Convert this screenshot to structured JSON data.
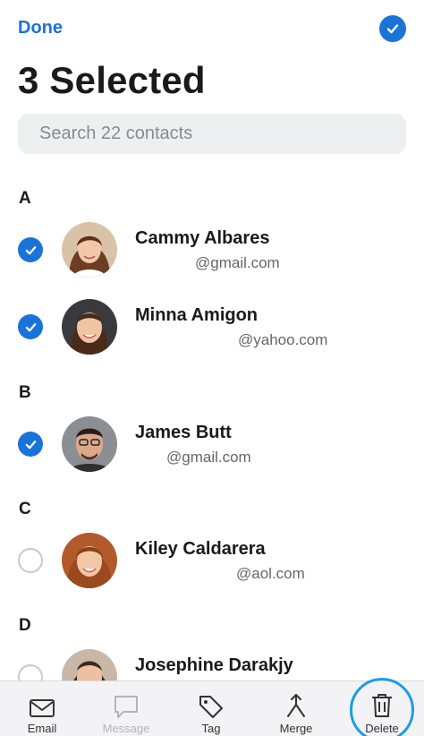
{
  "header": {
    "done_label": "Done",
    "title": "3 Selected"
  },
  "search": {
    "placeholder": "Search 22 contacts"
  },
  "sections": [
    {
      "letter": "A"
    },
    {
      "letter": "B"
    },
    {
      "letter": "C"
    },
    {
      "letter": "D"
    }
  ],
  "contacts": [
    {
      "name": "Cammy Albares",
      "email": "@gmail.com",
      "selected": true
    },
    {
      "name": "Minna Amigon",
      "email": "@yahoo.com",
      "selected": true
    },
    {
      "name": "James Butt",
      "email": "@gmail.com",
      "selected": true
    },
    {
      "name": "Kiley Caldarera",
      "email": "@aol.com",
      "selected": false
    },
    {
      "name": "Josephine Darakjy",
      "email": "",
      "selected": false
    }
  ],
  "toolbar": {
    "email_label": "Email",
    "message_label": "Message",
    "tag_label": "Tag",
    "merge_label": "Merge",
    "delete_label": "Delete"
  },
  "colors": {
    "accent": "#1a73d9",
    "highlight_ring": "#1e9be6"
  }
}
